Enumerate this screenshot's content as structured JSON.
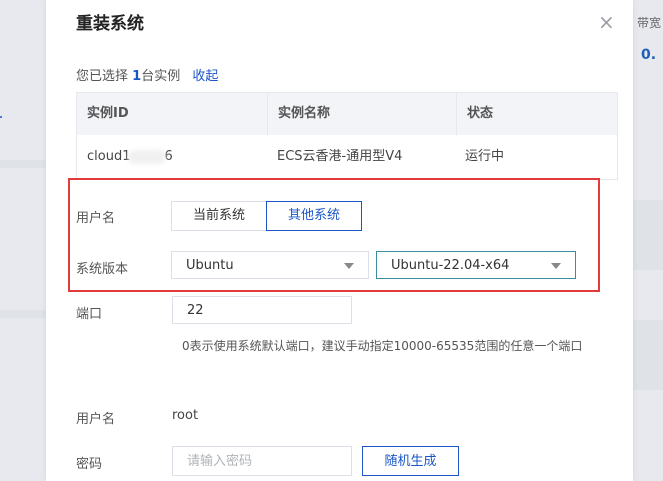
{
  "background": {
    "right_text_1": "带宽",
    "right_text_2": "0."
  },
  "dialog": {
    "title": "重装系统",
    "close_glyph": "×"
  },
  "selection": {
    "prefix": "您已选择 ",
    "count": "1",
    "suffix": "台实例",
    "collapse_label": "收起"
  },
  "table": {
    "headers": [
      "实例ID",
      "实例名称",
      "状态"
    ],
    "row": {
      "id_start": "cloud1",
      "id_end": "6",
      "name": "ECS云香港-通用型V4",
      "status": "运行中"
    }
  },
  "form": {
    "username_type": {
      "label": "用户名",
      "options": [
        "当前系统",
        "其他系统"
      ],
      "selected": "其他系统"
    },
    "os_version": {
      "label": "系统版本",
      "distro": "Ubuntu",
      "version": "Ubuntu-22.04-x64"
    },
    "port": {
      "label": "端口",
      "value": "22",
      "hint": "0表示使用系统默认端口，建议手动指定10000-65535范围的任意一个端口"
    },
    "username": {
      "label": "用户名",
      "value": "root"
    },
    "password": {
      "label": "密码",
      "placeholder": "请输入密码",
      "generate_label": "随机生成"
    }
  },
  "colors": {
    "accent": "#1a56c7",
    "status_running": "#2bae5a",
    "highlight_box": "#e23b3b"
  }
}
